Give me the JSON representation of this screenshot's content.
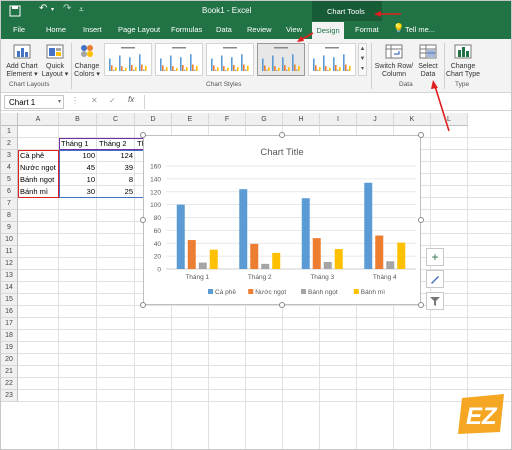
{
  "window": {
    "title": "Book1 - Excel",
    "contextual_tab_group": "Chart Tools",
    "ribbon_tabs": [
      "File",
      "Home",
      "Insert",
      "Page Layout",
      "Formulas",
      "Data",
      "Review",
      "View"
    ],
    "active_tab": "Design",
    "format_tab": "Format",
    "tell_me": "Tell me..."
  },
  "ribbon": {
    "add_chart_element": [
      "Add Chart",
      "Element"
    ],
    "quick_layout": [
      "Quick",
      "Layout"
    ],
    "change_colors": [
      "Change",
      "Colors"
    ],
    "switch_row_column": [
      "Switch Row/",
      "Column"
    ],
    "select_data": [
      "Select",
      "Data"
    ],
    "change_chart_type": [
      "Change",
      "Chart Type"
    ],
    "group_chart_layouts": "Chart Layouts",
    "group_chart_styles": "Chart Styles",
    "group_data": "Data",
    "group_type": "Type"
  },
  "formula_bar": {
    "name_box": "Chart 1",
    "cancel": "✕",
    "enter": "✓",
    "fx": "fx",
    "value": ""
  },
  "sheet": {
    "columns": [
      "A",
      "B",
      "C",
      "D",
      "E",
      "F",
      "G",
      "H",
      "I",
      "J",
      "K",
      "L"
    ],
    "rows": [
      "1",
      "2",
      "3",
      "4",
      "5",
      "6",
      "7",
      "8",
      "9",
      "10",
      "11",
      "12",
      "13",
      "14",
      "15",
      "16",
      "17",
      "18",
      "19",
      "20",
      "21",
      "22",
      "23"
    ],
    "headers": [
      "Tháng 1",
      "Tháng 2",
      "Tháng 3",
      "Tháng 4"
    ],
    "data": [
      {
        "label": "Cà phê",
        "values": [
          100,
          124,
          110,
          134
        ]
      },
      {
        "label": "Nước ngọt",
        "values": [
          45,
          39,
          48,
          52
        ]
      },
      {
        "label": "Bánh ngọt",
        "values": [
          10,
          8,
          11,
          12
        ]
      },
      {
        "label": "Bánh mì",
        "values": [
          30,
          25,
          31,
          41
        ]
      }
    ]
  },
  "chart_data": {
    "type": "bar",
    "title": "Chart Title",
    "categories": [
      "Tháng 1",
      "Tháng 2",
      "Tháng 3",
      "Tháng 4"
    ],
    "series": [
      {
        "name": "Cà phê",
        "values": [
          100,
          124,
          110,
          134
        ],
        "color": "#5b9bd5"
      },
      {
        "name": "Nước ngọt",
        "values": [
          45,
          39,
          48,
          52
        ],
        "color": "#ed7d31"
      },
      {
        "name": "Bánh ngọt",
        "values": [
          10,
          8,
          11,
          12
        ],
        "color": "#a5a5a5"
      },
      {
        "name": "Bánh mì",
        "values": [
          30,
          25,
          31,
          41
        ],
        "color": "#ffc000"
      }
    ],
    "yticks": [
      "0",
      "20",
      "40",
      "60",
      "80",
      "100",
      "120",
      "140",
      "160"
    ],
    "ylim": [
      0,
      160
    ],
    "grid": true,
    "legend": "bottom"
  },
  "chart_side_buttons": [
    "chart-elements",
    "chart-styles",
    "chart-filters"
  ],
  "logo": {
    "text": "EZ"
  },
  "colors": {
    "excel_green": "#217346",
    "annotation_red": "#e02020",
    "selection_purple": "#7030a0",
    "selection_red": "#e02020"
  }
}
